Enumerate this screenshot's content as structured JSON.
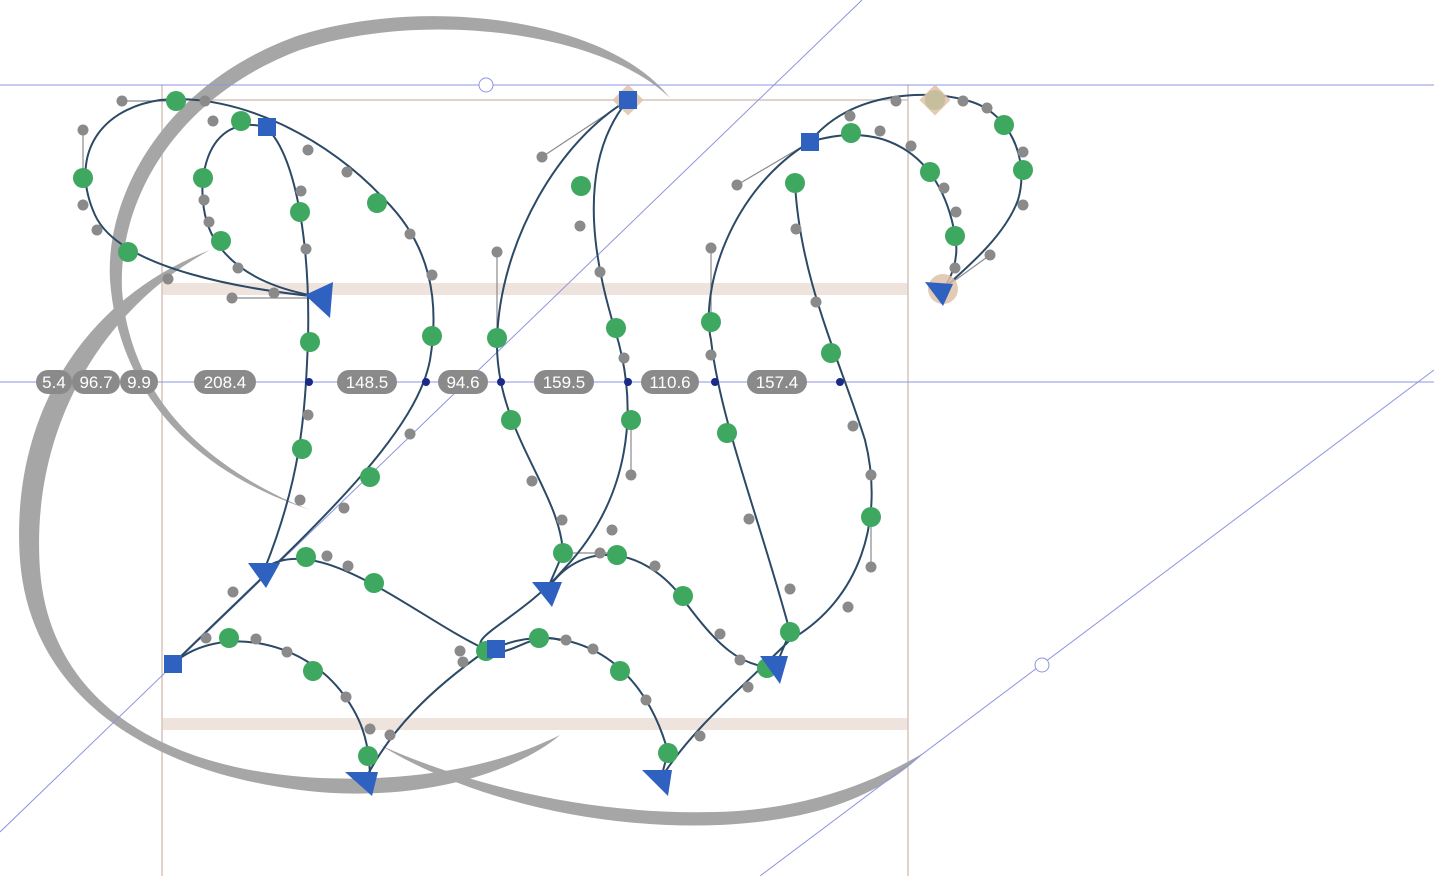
{
  "editor": {
    "colors": {
      "guideline": "#8c95e0",
      "metrics_line": "#c9a8a0",
      "zone_fill": "#efe4dd",
      "background_glyph": "#a0a0a0",
      "outline": "#2c4a66",
      "node_smooth": "#3fa860",
      "node_corner": "#2f62c0",
      "handle": "#8a8a8a",
      "measure_pill": "#8a8a8a",
      "measure_text": "#ffffff"
    },
    "measurement": {
      "values": [
        "5.4",
        "96.7",
        "9.9",
        "208.4",
        "148.5",
        "94.6",
        "159.5",
        "110.6",
        "157.4"
      ]
    },
    "node_icons": {
      "smooth": "green-circle-node",
      "corner": "blue-square-node",
      "start": "blue-triangle-start-node",
      "anchor": "tan-diamond-anchor"
    }
  }
}
